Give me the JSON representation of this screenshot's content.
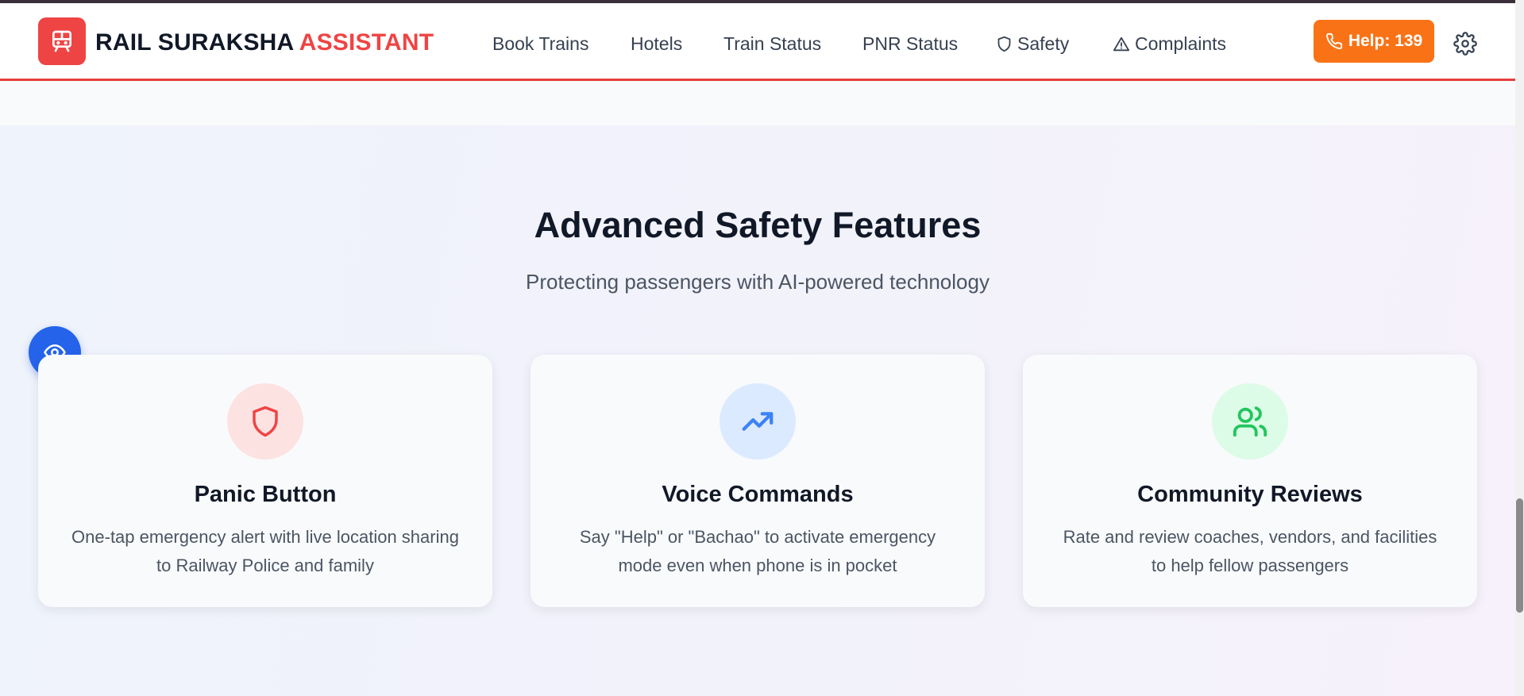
{
  "header": {
    "brand_main": "RAIL SURAKSHA",
    "brand_accent": "ASSISTANT",
    "nav": {
      "book_trains": "Book Trains",
      "hotels": "Hotels",
      "train_status": "Train Status",
      "pnr_status": "PNR Status",
      "safety": "Safety",
      "complaints": "Complaints"
    },
    "help_label": "Help: 139",
    "icons": {
      "logo": "train-icon",
      "safety": "shield-icon",
      "complaints": "warning-triangle-icon",
      "help": "phone-icon",
      "settings": "gear-icon"
    }
  },
  "section": {
    "title": "Advanced Safety Features",
    "subtitle": "Protecting passengers with AI-powered technology",
    "cards": [
      {
        "title": "Panic Button",
        "description": "One-tap emergency alert with live location sharing to Railway Police and family",
        "icon": "shield-icon",
        "icon_color": "#ef4444",
        "icon_bg": "#fde2e2"
      },
      {
        "title": "Voice Commands",
        "description": "Say \"Help\" or \"Bachao\" to activate emergency mode even when phone is in pocket",
        "icon": "trending-up-icon",
        "icon_color": "#3b82f6",
        "icon_bg": "#dbeafe"
      },
      {
        "title": "Community Reviews",
        "description": "Rate and review coaches, vendors, and facilities to help fellow passengers",
        "icon": "users-icon",
        "icon_color": "#22c55e",
        "icon_bg": "#dcfce7"
      }
    ]
  },
  "floating": {
    "accessibility_icon": "eye-icon"
  },
  "colors": {
    "brand_red": "#ef4444",
    "help_orange": "#f97316",
    "accessibility_blue": "#2563eb"
  }
}
